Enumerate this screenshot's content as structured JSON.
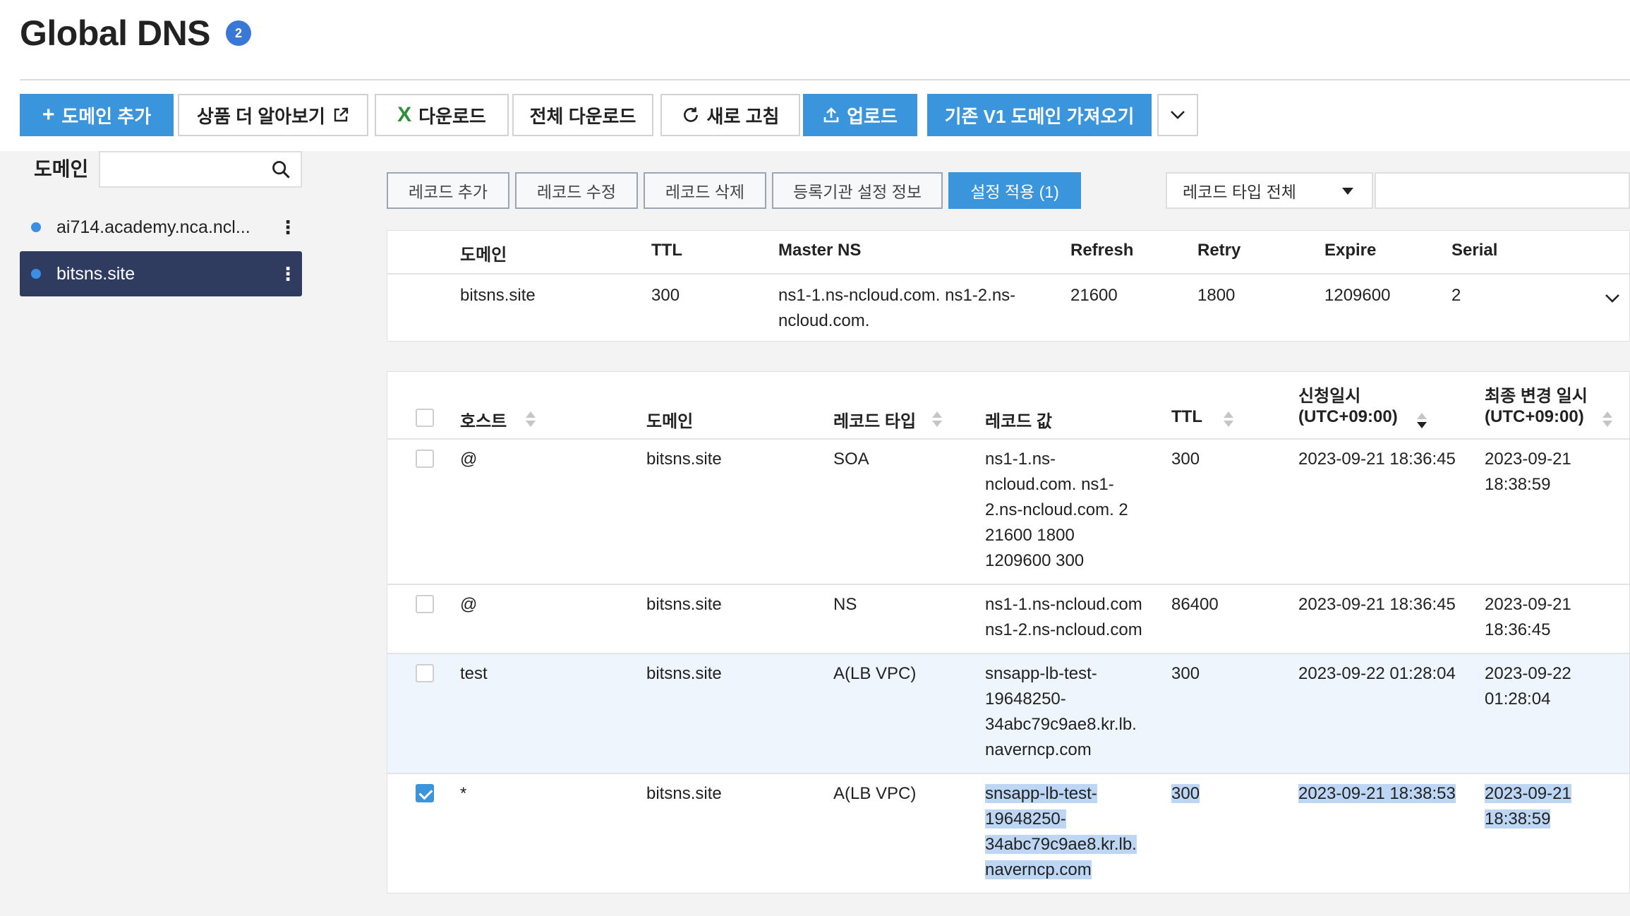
{
  "page": {
    "title": "Global DNS",
    "badge": "2"
  },
  "toolbar": {
    "add_domain": "도메인 추가",
    "learn_more": "상품 더 알아보기",
    "download": "다운로드",
    "download_all": "전체 다운로드",
    "refresh": "새로 고침",
    "upload": "업로드",
    "import_v1": "기존 V1 도메인 가져오기"
  },
  "sidebar": {
    "label": "도메인",
    "search_placeholder": "",
    "domains": [
      {
        "name": "ai714.academy.nca.ncl..."
      },
      {
        "name": "bitsns.site"
      }
    ]
  },
  "record_actions": {
    "add": "레코드 추가",
    "edit": "레코드 수정",
    "delete": "레코드 삭제",
    "registrar": "등록기관 설정 정보",
    "apply": "설정 적용 (1)"
  },
  "filter": {
    "type_select": "레코드 타입 전체",
    "search_placeholder": ""
  },
  "soa": {
    "headers": {
      "domain": "도메인",
      "ttl": "TTL",
      "master_ns": "Master NS",
      "refresh": "Refresh",
      "retry": "Retry",
      "expire": "Expire",
      "serial": "Serial"
    },
    "row": {
      "domain": "bitsns.site",
      "ttl": "300",
      "master_ns_line1": "ns1-1.ns-ncloud.com. ns1-2.ns-",
      "master_ns_line2": "ncloud.com.",
      "refresh": "21600",
      "retry": "1800",
      "expire": "1209600",
      "serial": "2"
    }
  },
  "records": {
    "headers": {
      "host": "호스트",
      "domain": "도메인",
      "type": "레코드 타입",
      "value": "레코드 값",
      "ttl": "TTL",
      "created_1": "신청일시",
      "created_2": "(UTC+09:00)",
      "modified_1": "최종 변경 일시",
      "modified_2": "(UTC+09:00)"
    },
    "rows": [
      {
        "host": "@",
        "domain": "bitsns.site",
        "type": "SOA",
        "value": [
          "ns1-1.ns-",
          "ncloud.com. ns1-",
          "2.ns-ncloud.com. 2",
          "21600 1800",
          "1209600 300"
        ],
        "ttl": "300",
        "created": "2023-09-21 18:36:45",
        "modified": [
          "2023-09-21",
          "18:38:59"
        ],
        "checked": false
      },
      {
        "host": "@",
        "domain": "bitsns.site",
        "type": "NS",
        "value": [
          "ns1-1.ns-ncloud.com",
          "ns1-2.ns-ncloud.com"
        ],
        "ttl": "86400",
        "created": "2023-09-21 18:36:45",
        "modified": [
          "2023-09-21",
          "18:36:45"
        ],
        "checked": false
      },
      {
        "host": "test",
        "domain": "bitsns.site",
        "type": "A(LB VPC)",
        "value": [
          "snsapp-lb-test-",
          "19648250-",
          "34abc79c9ae8.kr.lb.",
          "naverncp.com"
        ],
        "ttl": "300",
        "created": "2023-09-22 01:28:04",
        "modified": [
          "2023-09-22",
          "01:28:04"
        ],
        "checked": false
      },
      {
        "host": "*",
        "domain": "bitsns.site",
        "type": "A(LB VPC)",
        "value": [
          "snsapp-lb-test-",
          "19648250-",
          "34abc79c9ae8.kr.lb.",
          "naverncp.com"
        ],
        "ttl": "300",
        "created": "2023-09-21 18:38:53",
        "modified": [
          "2023-09-21",
          "18:38:59"
        ],
        "checked": true
      }
    ]
  },
  "colors": {
    "primary": "#3a95dc",
    "active_domain_bg": "#2f3b5f",
    "selection": "#bcd6f4"
  }
}
